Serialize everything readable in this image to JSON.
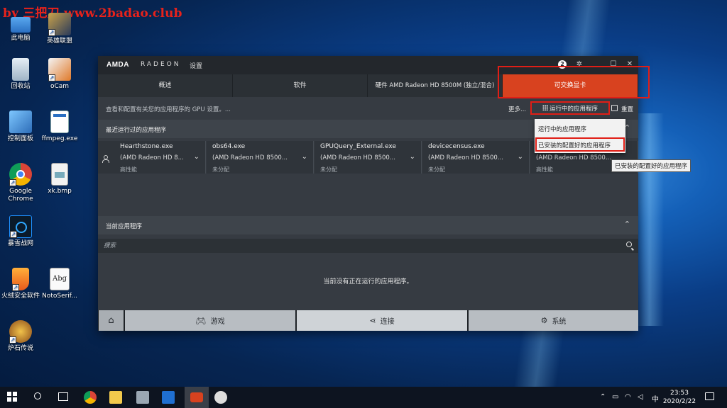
{
  "watermark": "by 三把刀 www.2badao.club",
  "desktop": {
    "icons": [
      {
        "label": "此电脑"
      },
      {
        "label": "英雄联盟"
      },
      {
        "label": "回收站"
      },
      {
        "label": "oCam"
      },
      {
        "label": "控制面板"
      },
      {
        "label": "ffmpeg.exe"
      },
      {
        "label": "Google Chrome"
      },
      {
        "label": "xk.bmp"
      },
      {
        "label": "暴雪战网"
      },
      {
        "label": "火绒安全软件"
      },
      {
        "label": "NotoSerif..."
      },
      {
        "label": "炉石传说"
      }
    ]
  },
  "window": {
    "brand": "AMDA",
    "product": "RADEON",
    "title": "设置",
    "notification_count": "2",
    "tabs": [
      {
        "label": "概述"
      },
      {
        "label": "软件"
      },
      {
        "label": "硬件 AMD Radeon HD 8500M (独立/混合)"
      },
      {
        "label": "可交换显卡"
      }
    ],
    "description": "查看和配置有关您的应用程序的 GPU 设置。...",
    "more_label": "更多...",
    "filter_label": "运行中的应用程序",
    "reset_label": "重置",
    "recent_section_title": "最近运行过的应用程序",
    "recent_apps": [
      {
        "name": "Hearthstone.exe",
        "gpu": "(AMD Radeon HD 8...",
        "status": "高性能"
      },
      {
        "name": "obs64.exe",
        "gpu": "(AMD Radeon HD 8500...",
        "status": "未分配"
      },
      {
        "name": "GPUQuery_External.exe",
        "gpu": "(AMD Radeon HD 8500...",
        "status": "未分配"
      },
      {
        "name": "devicecensus.exe",
        "gpu": "(AMD Radeon HD 8500...",
        "status": "未分配"
      },
      {
        "name": "",
        "gpu": "(AMD Radeon HD 8500...",
        "status": "高性能"
      }
    ],
    "current_section_title": "当前应用程序",
    "search_placeholder": "搜索",
    "empty_message": "当前没有正在运行的应用程序。",
    "bottom_nav": [
      {
        "label": "游戏"
      },
      {
        "label": "连接"
      },
      {
        "label": "系统"
      }
    ],
    "filter_menu": {
      "items": [
        {
          "label": "运行中的应用程序"
        },
        {
          "label": "已安装的配置好的应用程序"
        }
      ],
      "tooltip": "已安装的配置好的应用程序"
    }
  },
  "taskbar": {
    "ime": "中",
    "time": "23:53",
    "date": "2020/2/22"
  },
  "colors": {
    "accent": "#d8421f",
    "annotation": "#e01e16"
  }
}
